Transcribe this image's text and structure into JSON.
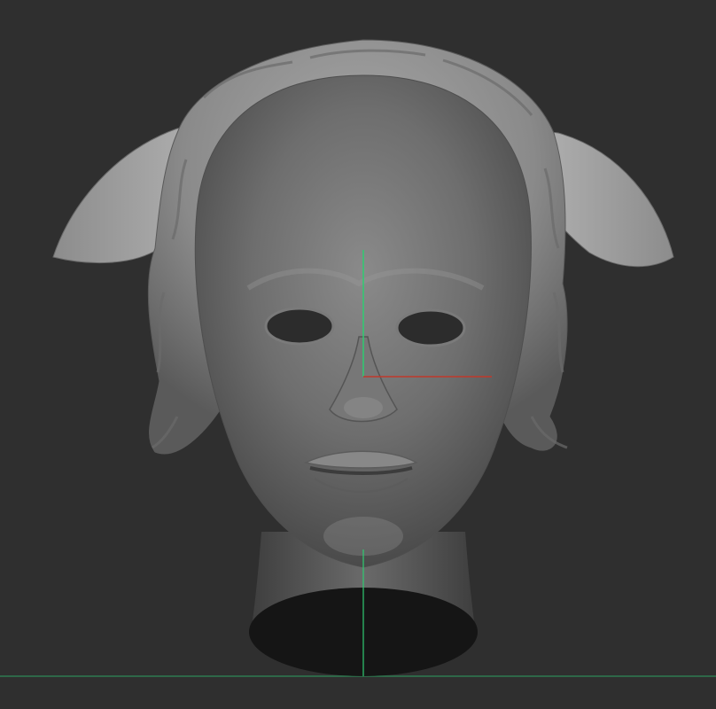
{
  "viewport": {
    "background": "#2f2f2f",
    "model": "sculpted-head",
    "gizmo_colors": {
      "x_axis": "#c0392b",
      "y_axis": "#2ecc71",
      "ground_line": "#2e8b57"
    }
  }
}
